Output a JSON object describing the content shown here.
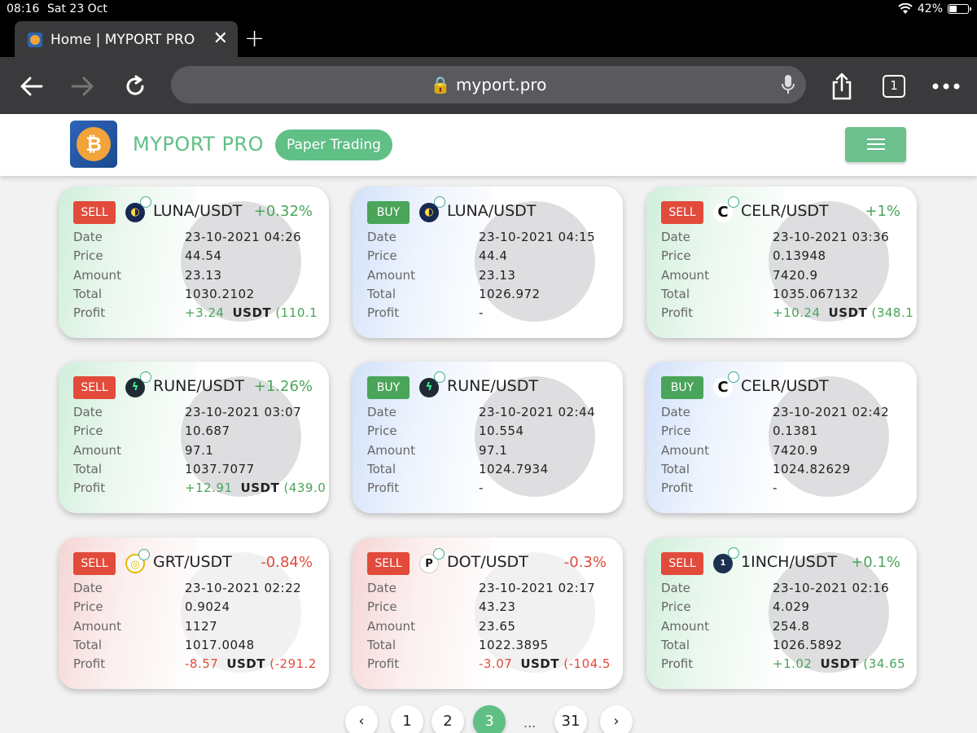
{
  "status": {
    "time": "08:16",
    "date": "Sat 23 Oct",
    "battery": "42%",
    "battery_level": 42
  },
  "browser": {
    "tab_title": "Home | MYPORT PRO",
    "url": "myport.pro",
    "tab_count": "1"
  },
  "site": {
    "logo_glyph": "₿",
    "brand": "MYPORT PRO",
    "mode": "Paper Trading"
  },
  "labels": {
    "date": "Date",
    "price": "Price",
    "amount": "Amount",
    "total": "Total",
    "profit": "Profit",
    "unit": "USDT"
  },
  "colors": {
    "accent": "#5fbf85",
    "sell": "#e24b3b",
    "buy": "#4aa55a"
  },
  "cards": [
    {
      "side": "SELL",
      "pair": "LUNA/USDT",
      "change": "+0.32%",
      "date": "23-10-2021 04:26",
      "price": "44.54",
      "amount": "23.13",
      "total": "1030.2102",
      "profit": "+3.24",
      "profit_usdt": "(110.1",
      "icon": "luna-icon"
    },
    {
      "side": "BUY",
      "pair": "LUNA/USDT",
      "change": "",
      "date": "23-10-2021 04:15",
      "price": "44.4",
      "amount": "23.13",
      "total": "1026.972",
      "profit": "-",
      "profit_usdt": "",
      "icon": "luna-icon"
    },
    {
      "side": "SELL",
      "pair": "CELR/USDT",
      "change": "+1%",
      "date": "23-10-2021 03:36",
      "price": "0.13948",
      "amount": "7420.9",
      "total": "1035.067132",
      "profit": "+10.24",
      "profit_usdt": "(348.1",
      "icon": "celr-icon"
    },
    {
      "side": "SELL",
      "pair": "RUNE/USDT",
      "change": "+1.26%",
      "date": "23-10-2021 03:07",
      "price": "10.687",
      "amount": "97.1",
      "total": "1037.7077",
      "profit": "+12.91",
      "profit_usdt": "(439.0",
      "icon": "rune-icon"
    },
    {
      "side": "BUY",
      "pair": "RUNE/USDT",
      "change": "",
      "date": "23-10-2021 02:44",
      "price": "10.554",
      "amount": "97.1",
      "total": "1024.7934",
      "profit": "-",
      "profit_usdt": "",
      "icon": "rune-icon"
    },
    {
      "side": "BUY",
      "pair": "CELR/USDT",
      "change": "",
      "date": "23-10-2021 02:42",
      "price": "0.1381",
      "amount": "7420.9",
      "total": "1024.82629",
      "profit": "-",
      "profit_usdt": "",
      "icon": "celr-icon"
    },
    {
      "side": "SELL",
      "pair": "GRT/USDT",
      "change": "-0.84%",
      "date": "23-10-2021 02:22",
      "price": "0.9024",
      "amount": "1127",
      "total": "1017.0048",
      "profit": "-8.57",
      "profit_usdt": "(-291.2",
      "icon": "grt-icon"
    },
    {
      "side": "SELL",
      "pair": "DOT/USDT",
      "change": "-0.3%",
      "date": "23-10-2021 02:17",
      "price": "43.23",
      "amount": "23.65",
      "total": "1022.3895",
      "profit": "-3.07",
      "profit_usdt": "(-104.5",
      "icon": "dot-icon"
    },
    {
      "side": "SELL",
      "pair": "1INCH/USDT",
      "change": "+0.1%",
      "date": "23-10-2021 02:16",
      "price": "4.029",
      "amount": "254.8",
      "total": "1026.5892",
      "profit": "+1.02",
      "profit_usdt": "(34.65",
      "icon": "1inch-icon"
    }
  ],
  "pagination": {
    "pages": [
      "1",
      "2",
      "3",
      "31"
    ],
    "current": "3",
    "ellipsis": "..."
  }
}
